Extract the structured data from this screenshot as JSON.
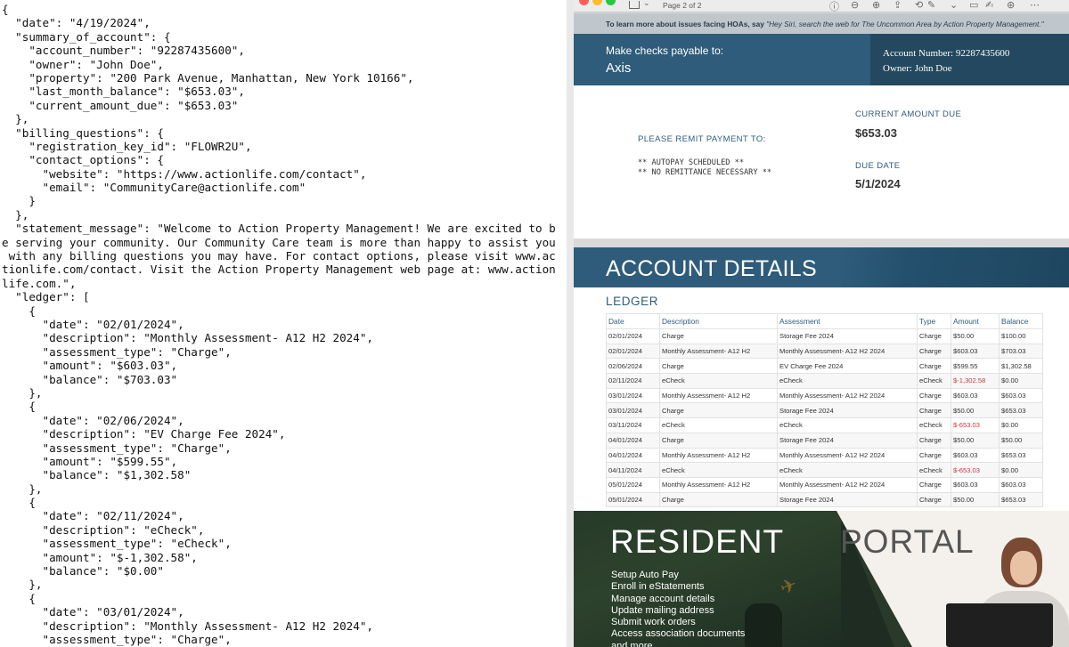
{
  "editor": {
    "lines": [
      "{",
      "  \"date\": \"4/19/2024\",",
      "  \"summary_of_account\": {",
      "    \"account_number\": \"92287435600\",",
      "    \"owner\": \"John Doe\",",
      "    \"property\": \"200 Park Avenue, Manhattan, New York 10166\",",
      "    \"last_month_balance\": \"$653.03\",",
      "    \"current_amount_due\": \"$653.03\"",
      "  },",
      "  \"billing_questions\": {",
      "    \"registration_key_id\": \"FLOWR2U\",",
      "    \"contact_options\": {",
      "      \"website\": \"https://www.actionlife.com/contact\",",
      "      \"email\": \"CommunityCare@actionlife.com\"",
      "    }",
      "  },",
      "  \"statement_message\": \"Welcome to Action Property Management! We are excited to b",
      "e serving your community. Our Community Care team is more than happy to assist you",
      " with any billing questions you may have. For contact options, please visit www.ac",
      "tionlife.com/contact. Visit the Action Property Management web page at: www.action",
      "life.com.\",",
      "  \"ledger\": [",
      "    {",
      "      \"date\": \"02/01/2024\",",
      "      \"description\": \"Monthly Assessment- A12 H2 2024\",",
      "      \"assessment_type\": \"Charge\",",
      "      \"amount\": \"$603.03\",",
      "      \"balance\": \"$703.03\"",
      "    },",
      "    {",
      "      \"date\": \"02/06/2024\",",
      "      \"description\": \"EV Charge Fee 2024\",",
      "      \"assessment_type\": \"Charge\",",
      "      \"amount\": \"$599.55\",",
      "      \"balance\": \"$1,302.58\"",
      "    },",
      "    {",
      "      \"date\": \"02/11/2024\",",
      "      \"description\": \"eCheck\",",
      "      \"assessment_type\": \"eCheck\",",
      "      \"amount\": \"$-1,302.58\",",
      "      \"balance\": \"$0.00\"",
      "    },",
      "    {",
      "      \"date\": \"03/01/2024\",",
      "      \"description\": \"Monthly Assessment- A12 H2 2024\",",
      "      \"assessment_type\": \"Charge\","
    ]
  },
  "viewer": {
    "page_label": "Page 2 of 2",
    "hint": {
      "prefix": "To learn more about issues facing HOAs, say ",
      "quote": "\"Hey Siri, search the web for The Uncommon Area by Action Property Management.\""
    },
    "payable_label": "Make checks payable to:",
    "payee": "Axis",
    "account_line": "Account Number:  92287435600",
    "owner_line": "Owner:  John Doe",
    "remit_label": "PLEASE REMIT PAYMENT TO:",
    "autopay_line1": "** AUTOPAY SCHEDULED **",
    "autopay_line2": "** NO REMITTANCE NECESSARY **",
    "current_amount_due_label": "CURRENT AMOUNT DUE",
    "current_amount_due": "$653.03",
    "due_date_label": "DUE DATE",
    "due_date": "5/1/2024",
    "account_details_title": "ACCOUNT DETAILS",
    "ledger_title": "LEDGER",
    "ledger_headers": [
      "Date",
      "Description",
      "Assessment",
      "Type",
      "Amount",
      "Balance"
    ],
    "ledger_rows": [
      [
        "02/01/2024",
        "Charge",
        "Storage Fee 2024",
        "Charge",
        "$50.00",
        "$100.00"
      ],
      [
        "02/01/2024",
        "Monthly Assessment- A12 H2",
        "Monthly Assessment- A12 H2 2024",
        "Charge",
        "$603.03",
        "$703.03"
      ],
      [
        "02/06/2024",
        "Charge",
        "EV Charge Fee 2024",
        "Charge",
        "$599.55",
        "$1,302.58"
      ],
      [
        "02/11/2024",
        "eCheck",
        "eCheck",
        "eCheck",
        "$-1,302.58",
        "$0.00"
      ],
      [
        "03/01/2024",
        "Monthly Assessment- A12 H2",
        "Monthly Assessment- A12 H2 2024",
        "Charge",
        "$603.03",
        "$603.03"
      ],
      [
        "03/01/2024",
        "Charge",
        "Storage Fee 2024",
        "Charge",
        "$50.00",
        "$653.03"
      ],
      [
        "03/11/2024",
        "eCheck",
        "eCheck",
        "eCheck",
        "$-653.03",
        "$0.00"
      ],
      [
        "04/01/2024",
        "Charge",
        "Storage Fee 2024",
        "Charge",
        "$50.00",
        "$50.00"
      ],
      [
        "04/01/2024",
        "Monthly Assessment- A12 H2",
        "Monthly Assessment- A12 H2 2024",
        "Charge",
        "$603.03",
        "$653.03"
      ],
      [
        "04/11/2024",
        "eCheck",
        "eCheck",
        "eCheck",
        "$-653.03",
        "$0.00"
      ],
      [
        "05/01/2024",
        "Monthly Assessment- A12 H2",
        "Monthly Assessment- A12 H2 2024",
        "Charge",
        "$603.03",
        "$603.03"
      ],
      [
        "05/01/2024",
        "Charge",
        "Storage Fee 2024",
        "Charge",
        "$50.00",
        "$653.03"
      ]
    ],
    "portal": {
      "resident_word": "RESIDENT",
      "portal_word": "PORTAL",
      "items": [
        "Setup Auto Pay",
        "Enroll in eStatements",
        "Manage account details",
        "Update mailing address",
        "Submit work orders",
        "Access association documents",
        "and more"
      ]
    },
    "colors": {
      "brand_blue": "#2e5c7a",
      "negative_red": "#c73a3a"
    }
  }
}
